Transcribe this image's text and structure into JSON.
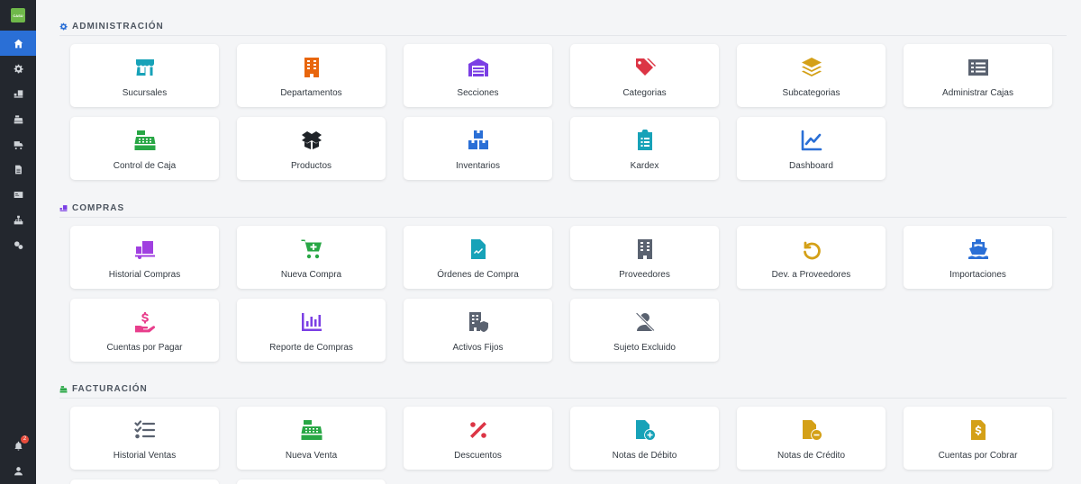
{
  "app": {
    "logo_text": "CASU"
  },
  "sidebar": {
    "notification_count": "2",
    "items": [
      "home-icon",
      "gear-icon",
      "truck-ramp-icon",
      "cash-register-icon",
      "truck-icon",
      "document-icon",
      "id-card-icon",
      "sitemap-icon",
      "gears-icon"
    ]
  },
  "sections": {
    "admin": {
      "title": "ADMINISTRACIÓN",
      "accent": "#2a6fd6",
      "cards": [
        {
          "label": "Sucursales",
          "icon": "store-icon",
          "color": "#17a2b8"
        },
        {
          "label": "Departamentos",
          "icon": "building-icon",
          "color": "#e8660d"
        },
        {
          "label": "Secciones",
          "icon": "warehouse-icon",
          "color": "#7b3fe4"
        },
        {
          "label": "Categorias",
          "icon": "tags-icon",
          "color": "#dc3545"
        },
        {
          "label": "Subcategorias",
          "icon": "layers-icon",
          "color": "#d4a017"
        },
        {
          "label": "Administrar Cajas",
          "icon": "list-icon",
          "color": "#5a6270"
        },
        {
          "label": "Control de Caja",
          "icon": "cash-register-icon",
          "color": "#28a745"
        },
        {
          "label": "Productos",
          "icon": "box-open-icon",
          "color": "#1f2328"
        },
        {
          "label": "Inventarios",
          "icon": "boxes-icon",
          "color": "#2a6fd6"
        },
        {
          "label": "Kardex",
          "icon": "clipboard-list-icon",
          "color": "#17a2b8"
        },
        {
          "label": "Dashboard",
          "icon": "chart-line-icon",
          "color": "#2a6fd6"
        }
      ]
    },
    "compras": {
      "title": "COMPRAS",
      "accent": "#7b3fe4",
      "cards": [
        {
          "label": "Historial Compras",
          "icon": "dolly-icon",
          "color": "#a040e0"
        },
        {
          "label": "Nueva Compra",
          "icon": "cart-plus-icon",
          "color": "#28a745"
        },
        {
          "label": "Órdenes de Compra",
          "icon": "file-invoice-icon",
          "color": "#17a2b8"
        },
        {
          "label": "Proveedores",
          "icon": "building-icon",
          "color": "#5a6270"
        },
        {
          "label": "Dev. a Proveedores",
          "icon": "undo-icon",
          "color": "#d4a017"
        },
        {
          "label": "Importaciones",
          "icon": "ship-icon",
          "color": "#2a6fd6"
        },
        {
          "label": "Cuentas por Pagar",
          "icon": "hand-dollar-icon",
          "color": "#e83e8c"
        },
        {
          "label": "Reporte de Compras",
          "icon": "chart-bar-icon",
          "color": "#7b3fe4"
        },
        {
          "label": "Activos Fijos",
          "icon": "building-shield-icon",
          "color": "#5a6270"
        },
        {
          "label": "Sujeto Excluido",
          "icon": "user-slash-icon",
          "color": "#5a6270"
        }
      ]
    },
    "facturacion": {
      "title": "FACTURACIÓN",
      "accent": "#28a745",
      "cards": [
        {
          "label": "Historial Ventas",
          "icon": "list-check-icon",
          "color": "#5a6270"
        },
        {
          "label": "Nueva Venta",
          "icon": "cash-register-icon",
          "color": "#28a745"
        },
        {
          "label": "Descuentos",
          "icon": "percent-icon",
          "color": "#dc3545"
        },
        {
          "label": "Notas de Débito",
          "icon": "file-plus-icon",
          "color": "#17a2b8"
        },
        {
          "label": "Notas de Crédito",
          "icon": "file-minus-icon",
          "color": "#d4a017"
        },
        {
          "label": "Cuentas por Cobrar",
          "icon": "file-dollar-icon",
          "color": "#d4a017"
        }
      ]
    }
  }
}
